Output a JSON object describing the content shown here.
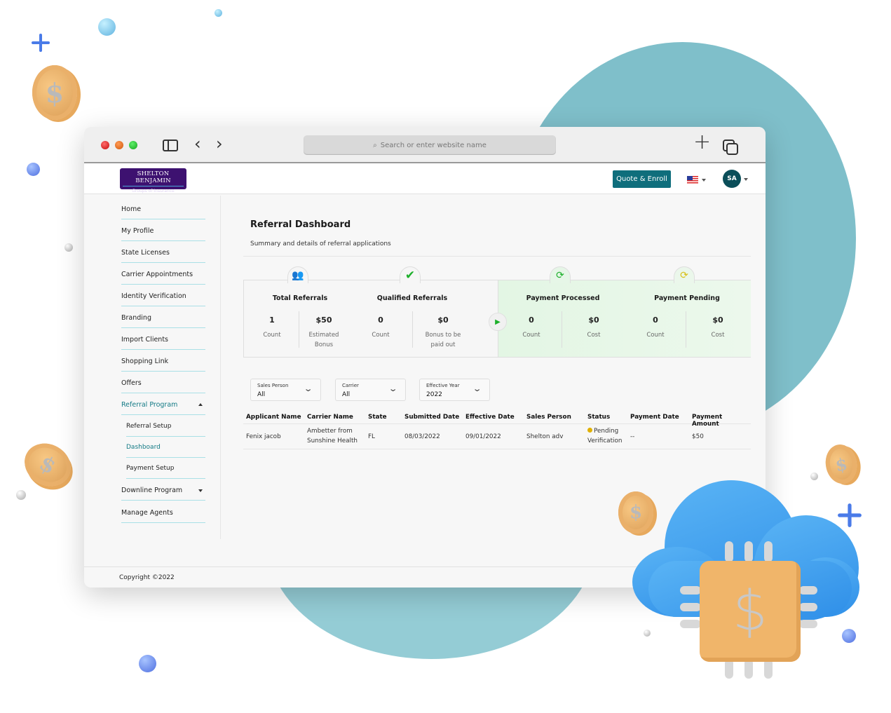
{
  "browser": {
    "url_placeholder": "Search or enter website name",
    "icons": {
      "sidebar": "sidebar-toggle-icon",
      "back": "‹",
      "forward": "›",
      "new_tab": "+",
      "tabs": "tabs-overview-icon",
      "search": "⌕"
    }
  },
  "header": {
    "logo_line1": "SHELTON BENJAMIN",
    "logo_line2": "Groups of Insurance",
    "quote_button": "Quote & Enroll",
    "language": "US",
    "avatar_initials": "SA",
    "accent_color": "#0f6e7c"
  },
  "sidebar": {
    "items": [
      {
        "label": "Home"
      },
      {
        "label": "My Profile"
      },
      {
        "label": "State Licenses"
      },
      {
        "label": "Carrier Appointments"
      },
      {
        "label": "Identity Verification"
      },
      {
        "label": "Branding"
      },
      {
        "label": "Import Clients"
      },
      {
        "label": "Shopping Link"
      },
      {
        "label": "Offers"
      },
      {
        "label": "Referral Program",
        "expanded": true,
        "active": true
      },
      {
        "label": "Referral Setup",
        "sub": true
      },
      {
        "label": "Dashboard",
        "sub": true,
        "active": true
      },
      {
        "label": "Payment Setup",
        "sub": true
      },
      {
        "label": "Downline Program",
        "expanded": false
      },
      {
        "label": "Manage Agents"
      }
    ]
  },
  "main": {
    "title": "Referral Dashboard",
    "subtitle": "Summary and details of referral applications",
    "stats": {
      "total_referrals": {
        "title": "Total Referrals",
        "count": "1",
        "count_label": "Count",
        "bonus": "$50",
        "bonus_label": "Estimated Bonus"
      },
      "qualified_referrals": {
        "title": "Qualified Referrals",
        "count": "0",
        "count_label": "Count",
        "bonus": "$0",
        "bonus_label": "Bonus to be paid out"
      },
      "payment_processed": {
        "title": "Payment Processed",
        "count": "0",
        "count_label": "Count",
        "cost": "$0",
        "cost_label": "Cost"
      },
      "payment_pending": {
        "title": "Payment Pending",
        "count": "0",
        "count_label": "Count",
        "cost": "$0",
        "cost_label": "Cost"
      }
    },
    "filters": [
      {
        "label": "Sales Person",
        "value": "All"
      },
      {
        "label": "Carrier",
        "value": "All"
      },
      {
        "label": "Effective Year",
        "value": "2022"
      }
    ],
    "table": {
      "columns": [
        "Applicant Name",
        "Carrier Name",
        "State",
        "Submitted Date",
        "Effective Date",
        "Sales Person",
        "Status",
        "Payment Date",
        "Payment Amount"
      ],
      "rows": [
        {
          "applicant": "Fenix jacob",
          "carrier_line1": "Ambetter from",
          "carrier_line2": "Sunshine Health",
          "state": "FL",
          "submitted": "08/03/2022",
          "effective": "09/01/2022",
          "sales_person": "Shelton adv",
          "status_line1": "Pending",
          "status_line2": "Verification",
          "status_color": "#e0b000",
          "payment_date": "--",
          "payment_amount": "$50"
        }
      ]
    }
  },
  "footer": {
    "copyright": "Copyright ©2022"
  },
  "decor": {
    "coin_symbol": "$",
    "chip_symbol": "$"
  }
}
